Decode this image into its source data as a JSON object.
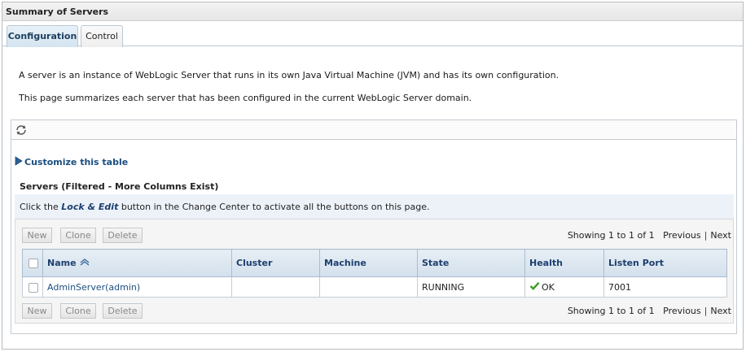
{
  "title": "Summary of Servers",
  "tabs": [
    {
      "label": "Configuration",
      "active": true
    },
    {
      "label": "Control",
      "active": false
    }
  ],
  "description": [
    "A server is an instance of WebLogic Server that runs in its own Java Virtual Machine (JVM) and has its own configuration.",
    "This page summarizes each server that has been configured in the current WebLogic Server domain."
  ],
  "customize_label": "Customize this table",
  "table_title": "Servers (Filtered - More Columns Exist)",
  "info": {
    "prefix": "Click the ",
    "emphasis": "Lock & Edit",
    "suffix": " button in the Change Center to activate all the buttons on this page."
  },
  "buttons": {
    "new": "New",
    "clone": "Clone",
    "delete": "Delete"
  },
  "pager": {
    "showing": "Showing 1 to 1 of 1",
    "previous": "Previous",
    "separator": "|",
    "next": "Next"
  },
  "columns": [
    "Name",
    "Cluster",
    "Machine",
    "State",
    "Health",
    "Listen Port"
  ],
  "rows": [
    {
      "name": "AdminServer(admin)",
      "cluster": "",
      "machine": "",
      "state": "RUNNING",
      "health": "OK",
      "listen_port": "7001"
    }
  ],
  "icons": {
    "refresh": "refresh-icon",
    "customize": "triangle-right-icon",
    "sort": "sort-ascending-icon",
    "health": "checkmark-icon"
  },
  "colors": {
    "link": "#1c4e80",
    "header_text": "#1c3f6e",
    "ok_check": "#3a9a1e",
    "info_bg": "#edf2f9"
  }
}
